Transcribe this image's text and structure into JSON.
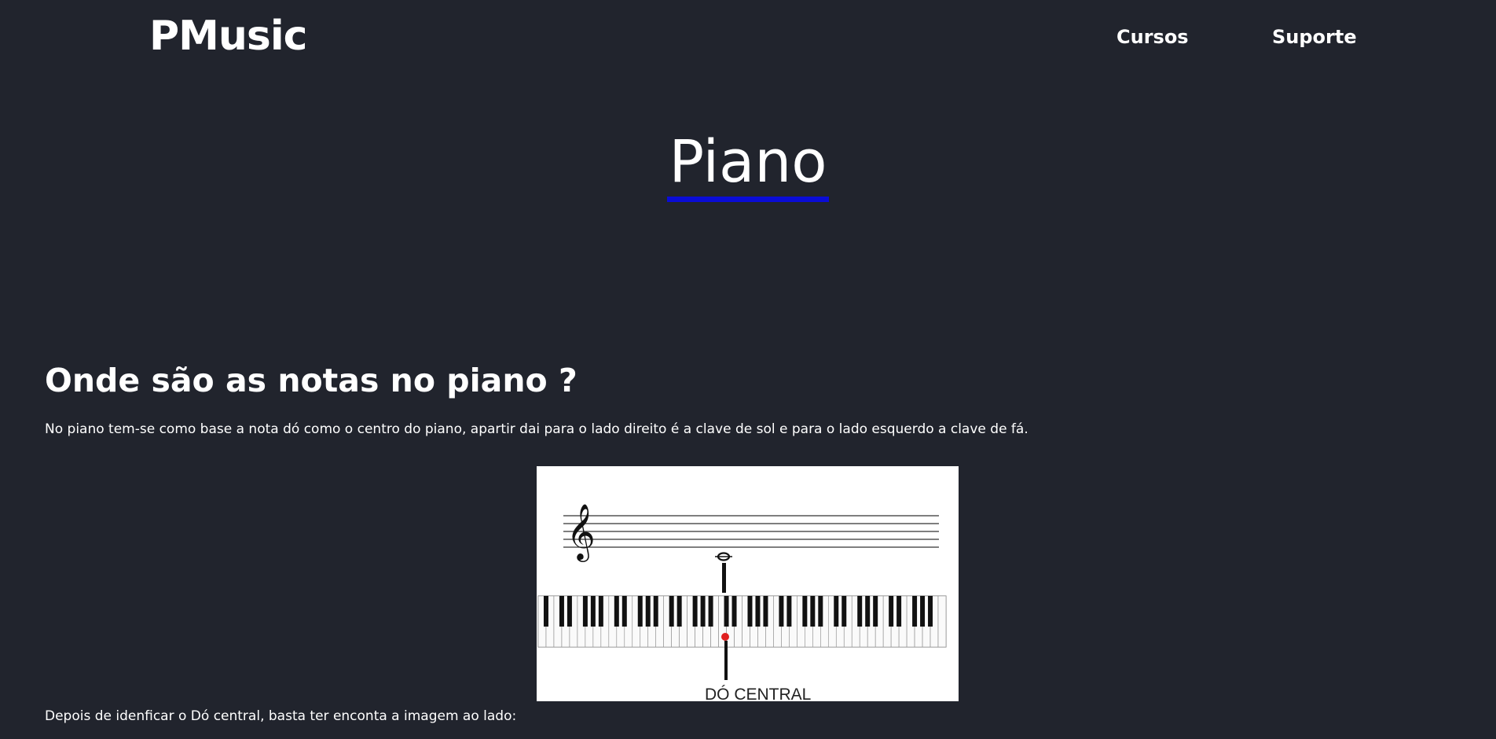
{
  "header": {
    "brand": "PMusic",
    "nav": [
      {
        "label": "Cursos"
      },
      {
        "label": "Suporte"
      }
    ]
  },
  "main": {
    "title": "Piano",
    "section": {
      "heading": "Onde são as notas no piano ?",
      "intro": "No piano tem-se como base a nota dó como o centro do piano, apartir dai para o lado direito é a clave de sol e para o lado esquerdo a clave de fá.",
      "figure": {
        "caption": "DÓ CENTRAL",
        "icons": [
          "treble-clef-icon",
          "whole-note-icon",
          "piano-keyboard"
        ],
        "marker_color": "#e02020"
      },
      "after": "Depois de idenficar o Dó central, basta ter enconta a imagem ao lado:"
    }
  },
  "colors": {
    "background": "#21242d",
    "text": "#ffffff",
    "title_underline": "#0a0cd6"
  }
}
